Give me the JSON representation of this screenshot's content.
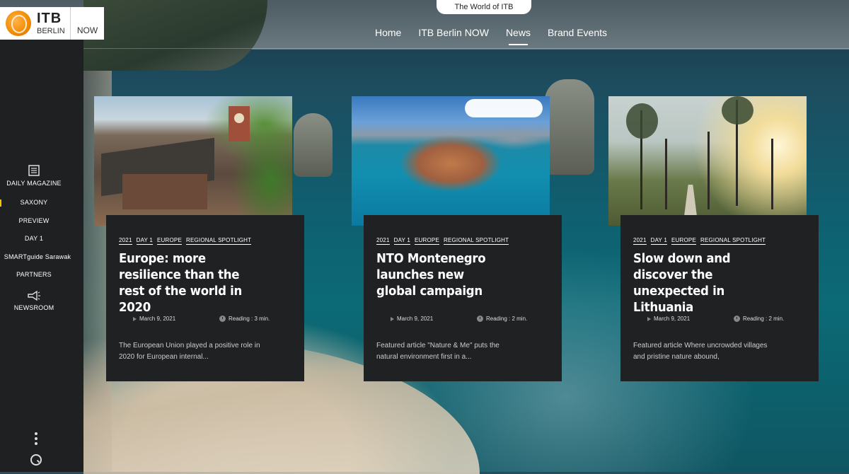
{
  "brand": {
    "name": "ITB",
    "sub": "BERLIN",
    "now": "NOW"
  },
  "world_tab": "The World of ITB",
  "topnav": [
    {
      "label": "Home",
      "active": false
    },
    {
      "label": "ITB Berlin NOW",
      "active": false
    },
    {
      "label": "News",
      "active": true
    },
    {
      "label": "Brand Events",
      "active": false
    }
  ],
  "sidebar": {
    "items": [
      {
        "label": "DAILY MAGAZINE",
        "icon": "newspaper-icon"
      },
      {
        "label": "SAXONY"
      },
      {
        "label": "PREVIEW"
      },
      {
        "label": "DAY 1"
      },
      {
        "label": "SMARTguide Sarawak"
      },
      {
        "label": "PARTNERS"
      },
      {
        "label": "NEWSROOM",
        "icon": "megaphone-icon"
      }
    ]
  },
  "cards": [
    {
      "tags": [
        "2021",
        "DAY 1",
        "EUROPE",
        "REGIONAL SPOTLIGHT"
      ],
      "title": "Europe: more resilience than the rest of the world in 2020",
      "date": "March 9, 2021",
      "reading": "Reading : 3 min.",
      "excerpt": "The European Union played a positive role in 2020 for European internal..."
    },
    {
      "tags": [
        "2021",
        "DAY 1",
        "EUROPE",
        "REGIONAL SPOTLIGHT"
      ],
      "title": "NTO Montenegro launches new global campaign",
      "date": "March 9, 2021",
      "reading": "Reading : 2 min.",
      "excerpt": "Featured article \"Nature & Me\" puts the natural environment first in a..."
    },
    {
      "tags": [
        "2021",
        "DAY 1",
        "EUROPE",
        "REGIONAL SPOTLIGHT"
      ],
      "title": "Slow down and discover the unexpected in Lithuania",
      "date": "March 9, 2021",
      "reading": "Reading : 2 min.",
      "excerpt": "Featured article Where uncrowded villages and pristine nature abound,"
    }
  ]
}
